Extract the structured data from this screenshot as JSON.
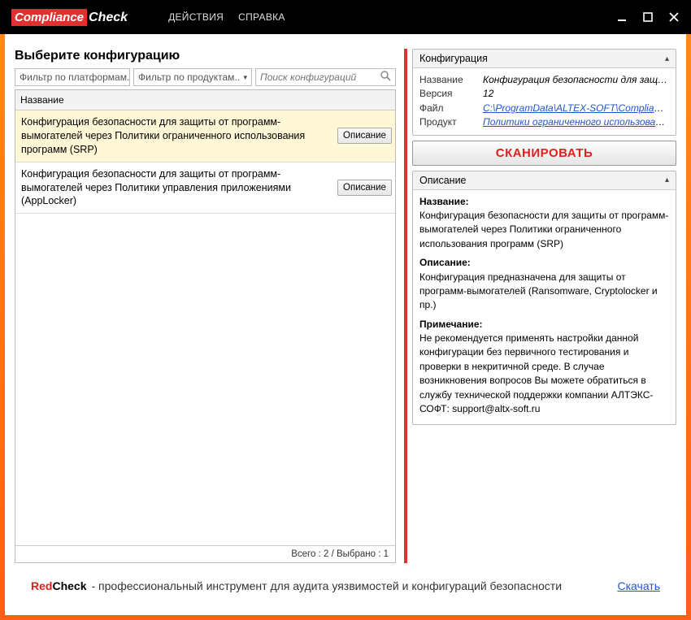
{
  "app": {
    "logo_badge": "Compliance",
    "logo_text": "Check",
    "menu": {
      "actions": "ДЕЙСТВИЯ",
      "help": "СПРАВКА"
    }
  },
  "left": {
    "title": "Выберите конфигурацию",
    "filter_platform": "Фильтр по платформам..",
    "filter_product": "Фильтр по продуктам..",
    "search_placeholder": "Поиск конфигураций",
    "col_name": "Название",
    "rows": [
      {
        "name": "Конфигурация безопасности для защиты от программ-вымогателей через Политики ограниченного использования программ (SRP)",
        "btn": "Описание",
        "selected": true
      },
      {
        "name": "Конфигурация безопасности для защиты от программ-вымогателей через Политики управления приложениями (AppLocker)",
        "btn": "Описание",
        "selected": false
      }
    ],
    "footer": "Всего : 2 / Выбрано : 1"
  },
  "right": {
    "config_header": "Конфигурация",
    "kv": {
      "name_key": "Название",
      "name_val": "Конфигурация безопасности для защиты от...",
      "ver_key": "Версия",
      "ver_val": "12",
      "file_key": "Файл",
      "file_val": "C:\\ProgramData\\ALTEX-SOFT\\ComplianceCheck...",
      "prod_key": "Продукт",
      "prod_val": "Политики ограниченного использования..."
    },
    "scan_label": "СКАНИРОВАТЬ",
    "desc_header": "Описание",
    "desc_name_title": "Название:",
    "desc_name_text": "Конфигурация безопасности для защиты от программ-вымогателей через Политики ограниченного использования программ (SRP)",
    "desc_desc_title": "Описание:",
    "desc_desc_text": "Конфигурация предназначена для защиты от программ-вымогателей (Ransomware, Cryptolocker и пр.)",
    "desc_note_title": "Примечание:",
    "desc_note_text": "Не рекомендуется применять настройки данной конфигурации без первичного тестирования и проверки в некритичной среде. В случае возникновения вопросов Вы можете обратиться в службу технической поддержки компании АЛТЭКС-СОФТ: support@altx-soft.ru"
  },
  "footer": {
    "brand_red": "Red",
    "brand_black": "Check",
    "text": " - профессиональный инструмент для аудита уязвимостей и конфигураций безопасности",
    "link": "Скачать"
  }
}
